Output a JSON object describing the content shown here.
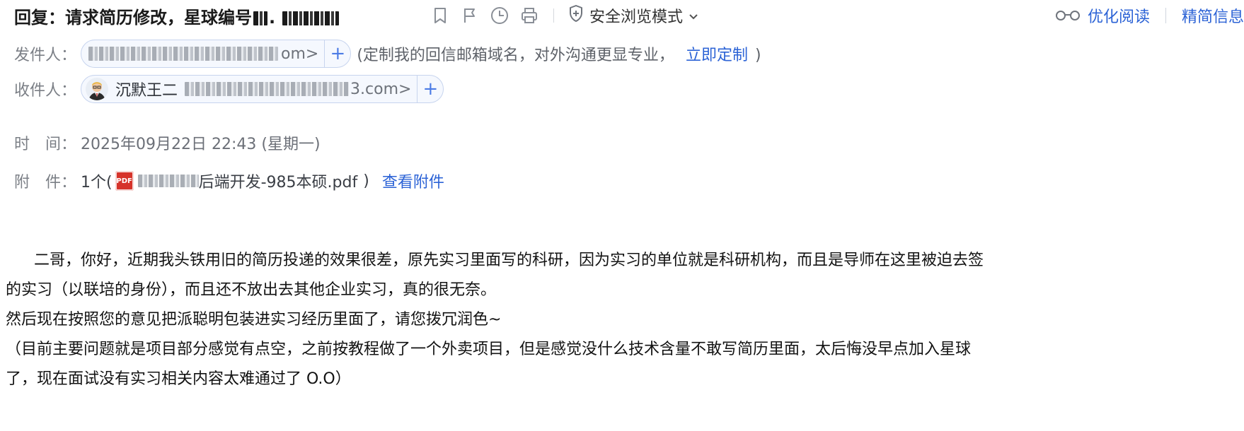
{
  "header": {
    "subject": "回复：请求简历修改，星球编号",
    "subject_suffix": ".",
    "safe_mode_label": "安全浏览模式",
    "optimize_read": "优化阅读",
    "brief_info": "精简信息"
  },
  "meta": {
    "sender_label": "发件人：",
    "sender_suffix": "om>",
    "sender_hint_open": "(定制我的回信邮箱域名，对外沟通更显专业，",
    "sender_hint_link": "立即定制",
    "sender_hint_close": ")",
    "recipient_label": "收件人：",
    "recipient_name": "沉默王二",
    "recipient_suffix": "3.com>",
    "time_label": "时　间：",
    "time_value": "2025年09月22日 22:43 (星期一)",
    "attach_label": "附　件：",
    "attach_count": "1个(",
    "attach_filename": "后端开发-985本硕.pdf",
    "attach_close": ")",
    "attach_view": "查看附件",
    "pdf_badge": "PDF"
  },
  "body": {
    "lines": [
      "　二哥，你好，近期我头铁用旧的简历投递的效果很差，原先实习里面写的科研，因为实习的单位就是科研机构，而且是导师在这里被迫去签",
      "的实习（以联培的身份），而且还不放出去其他企业实习，真的很无奈。",
      "然后现在按照您的意见把派聪明包装进实习经历里面了，请您拨冗润色~",
      "（目前主要问题就是项目部分感觉有点空，之前按教程做了一个外卖项目，但是感觉没什么技术含量不敢写简历里面，太后悔没早点加入星球",
      "了，现在面试没有实习相关内容太难通过了 O.O）"
    ]
  },
  "icons": {
    "bookmark": "bookmark-icon",
    "flag": "flag-icon",
    "clock": "clock-icon",
    "print": "print-icon",
    "shield": "shield-icon",
    "glasses": "glasses-icon"
  },
  "colors": {
    "link": "#2c63d6",
    "label": "#7b7f86",
    "chip_border": "#c7d4ee",
    "pdf": "#d6332a"
  }
}
